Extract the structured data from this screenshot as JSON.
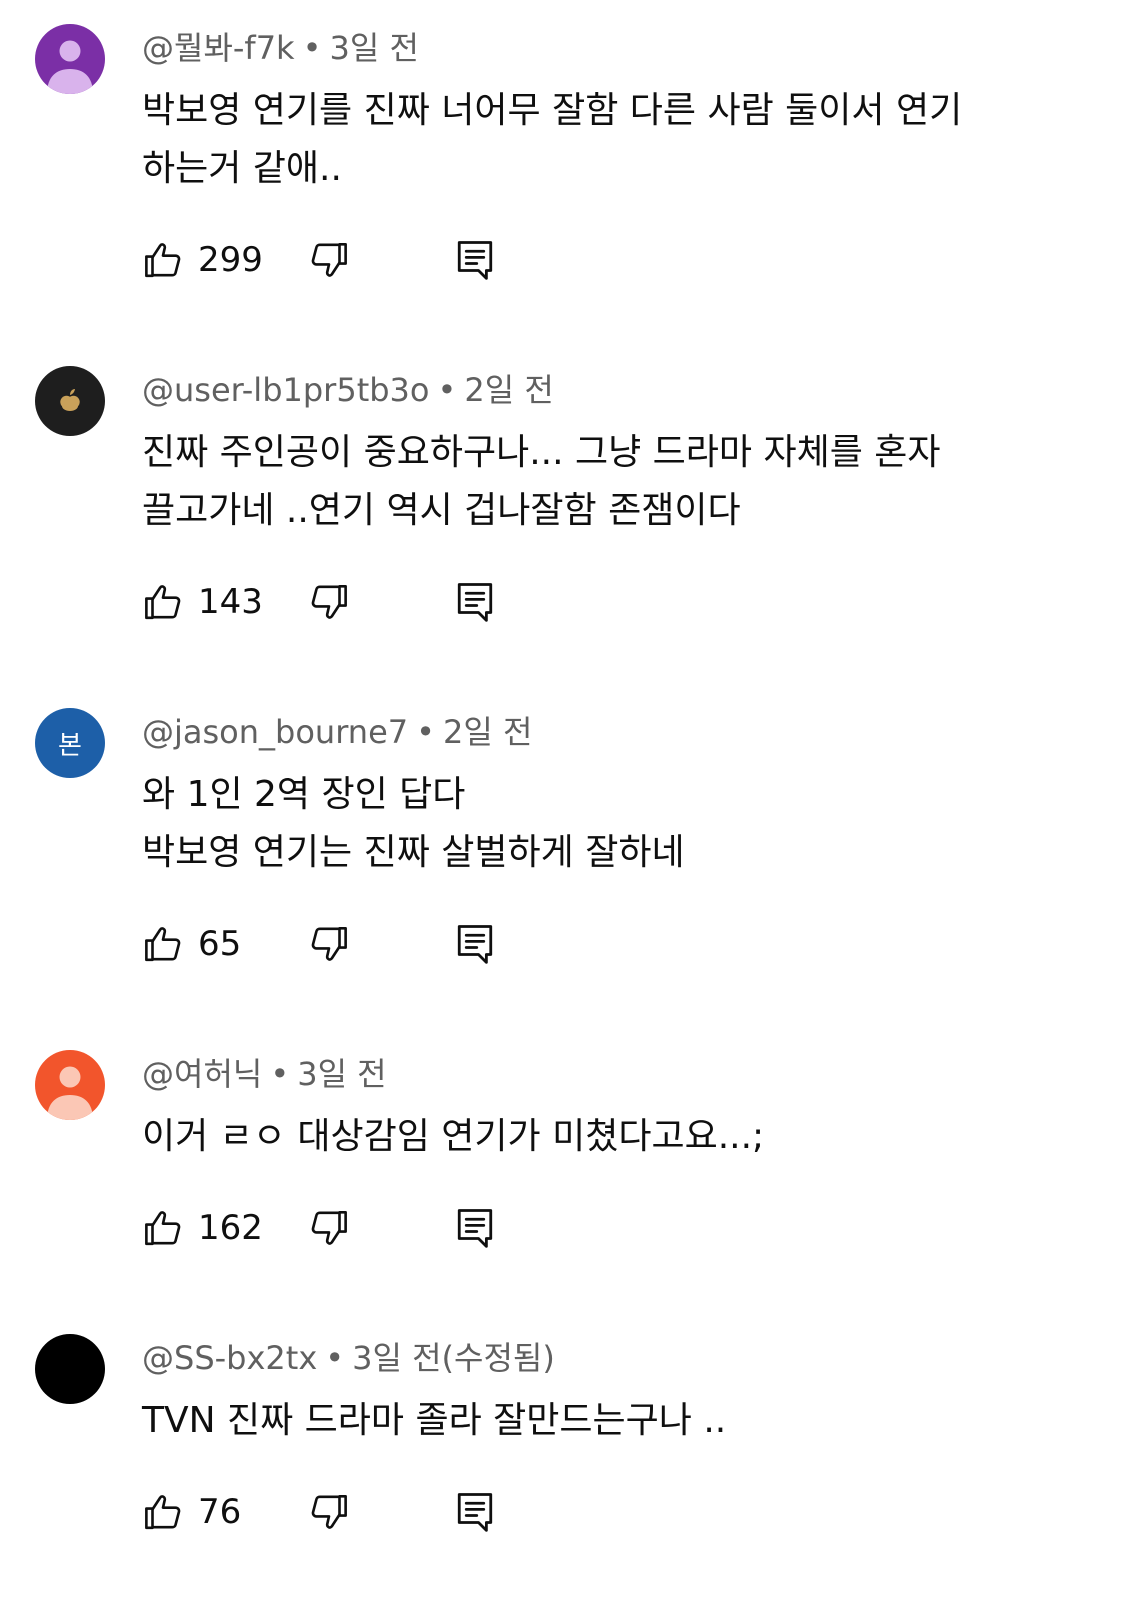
{
  "comments": [
    {
      "author": "@뭘봐-f7k",
      "separator": "•",
      "time": "3일 전",
      "lines": [
        "박보영 연기를 진짜 너어무 잘함 다른 사람 둘이서 연기",
        "하는거 같애.."
      ],
      "likes": "299",
      "avatar": {
        "type": "default",
        "bg": "#7b2fa6",
        "fg": "#d9b3ec"
      }
    },
    {
      "author": "@user-lb1pr5tb3o",
      "separator": "•",
      "time": "2일 전",
      "lines": [
        "진짜 주인공이 중요하구나... 그냥 드라마 자체를 혼자",
        "끌고가네 ..연기 역시 겁나잘함 존잼이다"
      ],
      "likes": "143",
      "avatar": {
        "type": "apple",
        "bg": "#1e1e1e",
        "fg": "#c9a15a"
      }
    },
    {
      "author": "@jason_bourne7",
      "separator": "•",
      "time": "2일 전",
      "lines": [
        "와 1인 2역 장인 답다",
        "박보영 연기는 진짜 살벌하게 잘하네"
      ],
      "likes": "65",
      "avatar": {
        "type": "letter",
        "bg": "#1d5fa8",
        "letter": "본"
      }
    },
    {
      "author": "@여허닉",
      "separator": "•",
      "time": "3일 전",
      "lines": [
        "이거 ㄹㅇ 대상감임 연기가 미쳤다고요...;"
      ],
      "likes": "162",
      "avatar": {
        "type": "default",
        "bg": "#f2552c",
        "fg": "#fbc7b5"
      }
    },
    {
      "author": "@SS-bx2tx",
      "separator": "•",
      "time": "3일 전(수정됨)",
      "lines": [
        "TVN 진짜 드라마 졸라 잘만드는구나 .."
      ],
      "likes": "76",
      "avatar": {
        "type": "solid",
        "bg": "#000000"
      }
    }
  ],
  "icons": {
    "like": "thumbs-up-outline-icon",
    "dislike": "thumbs-down-outline-icon",
    "reply": "comment-reply-icon"
  }
}
